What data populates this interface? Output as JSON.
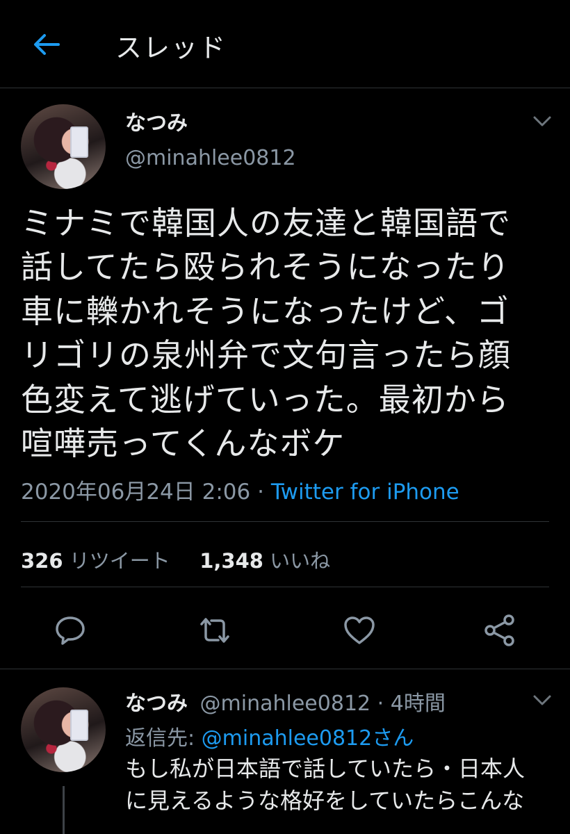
{
  "header": {
    "title": "スレッド",
    "back_icon": "arrow-left-icon",
    "accent": "#1d9bf0"
  },
  "tweet": {
    "author_name": "なつみ",
    "handle": "@minahlee0812",
    "text_lines": [
      "ミナミで韓国人の友達と韓国語で",
      "話してたら殴られそうになったり",
      "車に轢かれそうになったけど、ゴ",
      "リゴリの泉州弁で文句言ったら顔",
      "色変えて逃げていった。最初から",
      "喧嘩売ってくんなボケ"
    ],
    "timestamp": "2020年06月24日 2:06",
    "separator": "·",
    "source": "Twitter for iPhone",
    "retweets_count": "326",
    "retweets_label": "リツイート",
    "likes_count": "1,348",
    "likes_label": "いいね",
    "actions": [
      "reply-icon",
      "retweet-icon",
      "like-icon",
      "share-icon"
    ]
  },
  "reply": {
    "author_name": "なつみ",
    "handle": "@minahlee0812",
    "separator": "·",
    "time": "4時間",
    "reply_to_prefix": "返信先:",
    "reply_to": "@minahlee0812さん",
    "text_lines": [
      "もし私が日本語で話していたら・日本人",
      "に見えるような格好をしていたらこんな"
    ]
  }
}
